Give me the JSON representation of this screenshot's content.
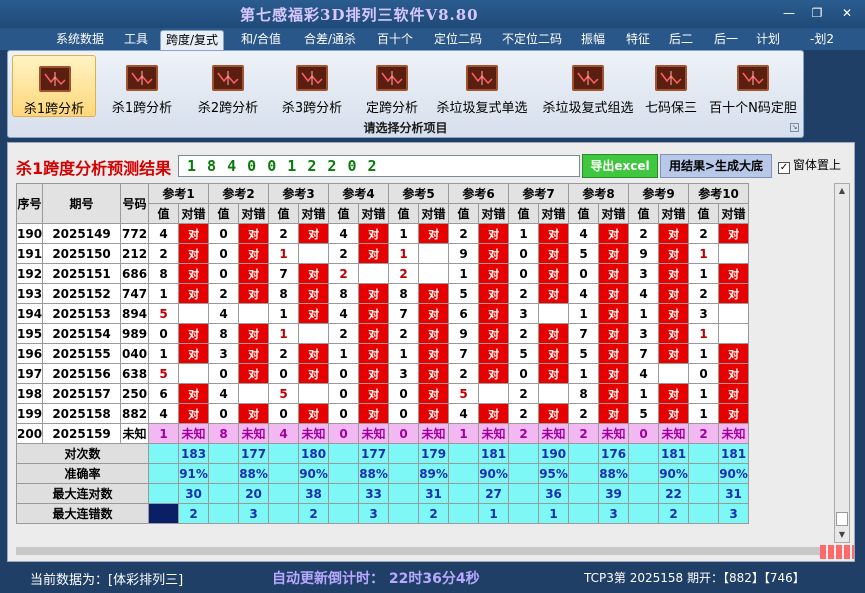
{
  "window": {
    "title": "第七感福彩3D排列三软件V8.80"
  },
  "menu": {
    "tabs": [
      "系统数据",
      "工具",
      "跨度/复式",
      "和/合值",
      "合差/通杀",
      "百十个",
      "定位二码",
      "不定位二码",
      "振幅",
      "特征",
      "后二",
      "后一",
      "计划",
      "-划2"
    ],
    "active_index": 2
  },
  "ribbon": {
    "buttons": [
      "杀1跨分析",
      "杀1跨分析",
      "杀2跨分析",
      "杀3跨分析",
      "定跨分析",
      "杀垃圾复式单选",
      "杀垃圾复式组选",
      "七码保三",
      "百十个N码定胆"
    ],
    "active_index": 0,
    "group_label": "请选择分析项目"
  },
  "result": {
    "title": "杀1跨度分析预测结果",
    "value": "1 8 4 0 0 1 2 2 0 2",
    "export_label": "导出excel",
    "generate_label": "用结果>生成大底",
    "topmost_label": "窗体置上",
    "topmost_checked": true
  },
  "table": {
    "head": {
      "seq": "序号",
      "period": "期号",
      "code": "号码",
      "value": "值",
      "match": "对错"
    },
    "refs": [
      "参考1",
      "参考2",
      "参考3",
      "参考4",
      "参考5",
      "参考6",
      "参考7",
      "参考8",
      "参考9",
      "参考10"
    ],
    "hit_text": "对",
    "rows": [
      {
        "seq": "190",
        "period": "2025149",
        "code": "772",
        "cells": [
          [
            "4",
            1
          ],
          [
            "0",
            1
          ],
          [
            "2",
            1
          ],
          [
            "4",
            1
          ],
          [
            "1",
            1
          ],
          [
            "2",
            1
          ],
          [
            "1",
            1
          ],
          [
            "4",
            1
          ],
          [
            "2",
            1
          ],
          [
            "2",
            1
          ]
        ]
      },
      {
        "seq": "191",
        "period": "2025150",
        "code": "212",
        "cells": [
          [
            "2",
            1
          ],
          [
            "0",
            1
          ],
          [
            "1r",
            0
          ],
          [
            "2",
            1
          ],
          [
            "1r",
            0
          ],
          [
            "9",
            1
          ],
          [
            "0",
            1
          ],
          [
            "5",
            1
          ],
          [
            "9",
            1
          ],
          [
            "1r",
            0
          ]
        ]
      },
      {
        "seq": "192",
        "period": "2025151",
        "code": "686",
        "cells": [
          [
            "8",
            1
          ],
          [
            "0",
            1
          ],
          [
            "7",
            1
          ],
          [
            "2r",
            0
          ],
          [
            "2r",
            0
          ],
          [
            "1",
            1
          ],
          [
            "0",
            1
          ],
          [
            "0",
            1
          ],
          [
            "3",
            1
          ],
          [
            "1",
            1
          ]
        ]
      },
      {
        "seq": "193",
        "period": "2025152",
        "code": "747",
        "cells": [
          [
            "1",
            1
          ],
          [
            "2",
            1
          ],
          [
            "8",
            1
          ],
          [
            "8",
            1
          ],
          [
            "8",
            1
          ],
          [
            "5",
            1
          ],
          [
            "2",
            1
          ],
          [
            "4",
            1
          ],
          [
            "4",
            1
          ],
          [
            "2",
            1
          ]
        ]
      },
      {
        "seq": "194",
        "period": "2025153",
        "code": "894",
        "cells": [
          [
            "5r",
            0
          ],
          [
            "4",
            0
          ],
          [
            "1",
            1
          ],
          [
            "4",
            1
          ],
          [
            "7",
            1
          ],
          [
            "6",
            1
          ],
          [
            "3",
            0
          ],
          [
            "1",
            1
          ],
          [
            "1",
            1
          ],
          [
            "3",
            0
          ]
        ]
      },
      {
        "seq": "195",
        "period": "2025154",
        "code": "989",
        "cells": [
          [
            "0",
            1
          ],
          [
            "8",
            1
          ],
          [
            "1r",
            0
          ],
          [
            "2",
            1
          ],
          [
            "2",
            1
          ],
          [
            "9",
            1
          ],
          [
            "2",
            1
          ],
          [
            "7",
            1
          ],
          [
            "3",
            1
          ],
          [
            "1r",
            0
          ]
        ]
      },
      {
        "seq": "196",
        "period": "2025155",
        "code": "040",
        "cells": [
          [
            "1",
            1
          ],
          [
            "3",
            1
          ],
          [
            "2",
            1
          ],
          [
            "1",
            1
          ],
          [
            "1",
            1
          ],
          [
            "7",
            1
          ],
          [
            "5",
            1
          ],
          [
            "5",
            1
          ],
          [
            "7",
            1
          ],
          [
            "1",
            1
          ]
        ]
      },
      {
        "seq": "197",
        "period": "2025156",
        "code": "638",
        "cells": [
          [
            "5r",
            0
          ],
          [
            "0",
            1
          ],
          [
            "0",
            1
          ],
          [
            "0",
            1
          ],
          [
            "3",
            1
          ],
          [
            "2",
            1
          ],
          [
            "0",
            1
          ],
          [
            "1",
            1
          ],
          [
            "4",
            0
          ],
          [
            "0",
            1
          ]
        ]
      },
      {
        "seq": "198",
        "period": "2025157",
        "code": "250",
        "cells": [
          [
            "6",
            1
          ],
          [
            "4",
            0
          ],
          [
            "5r",
            0
          ],
          [
            "0",
            1
          ],
          [
            "0",
            1
          ],
          [
            "5r",
            0
          ],
          [
            "2",
            0
          ],
          [
            "8",
            1
          ],
          [
            "1",
            1
          ],
          [
            "1",
            1
          ]
        ]
      },
      {
        "seq": "199",
        "period": "2025158",
        "code": "882",
        "cells": [
          [
            "4",
            1
          ],
          [
            "0",
            1
          ],
          [
            "0",
            1
          ],
          [
            "0",
            1
          ],
          [
            "0",
            1
          ],
          [
            "4",
            1
          ],
          [
            "2",
            1
          ],
          [
            "2",
            1
          ],
          [
            "5",
            1
          ],
          [
            "1",
            1
          ]
        ]
      }
    ],
    "unknown_row": {
      "seq": "200",
      "period": "2025159",
      "code": "未知",
      "unknown_text": "未知",
      "values": [
        "1",
        "8",
        "4",
        "0",
        "0",
        "1",
        "2",
        "2",
        "0",
        "2"
      ]
    },
    "stats": [
      {
        "label": "对次数",
        "values": [
          "183",
          "177",
          "180",
          "177",
          "179",
          "181",
          "190",
          "176",
          "181",
          "181"
        ]
      },
      {
        "label": "准确率",
        "values": [
          "91%",
          "88%",
          "90%",
          "88%",
          "89%",
          "90%",
          "95%",
          "88%",
          "90%",
          "90%"
        ]
      },
      {
        "label": "最大连对数",
        "values": [
          "30",
          "20",
          "38",
          "33",
          "31",
          "27",
          "36",
          "39",
          "22",
          "31"
        ]
      },
      {
        "label": "最大连错数",
        "values": [
          "2",
          "3",
          "2",
          "3",
          "2",
          "1",
          "1",
          "3",
          "2",
          "3"
        ]
      }
    ]
  },
  "status": {
    "current": "当前数据为：[体彩排列三]",
    "countdown": "自动更新倒计时：  22时36分4秒",
    "latest": "TCP3第 2025158 期开：【882】【746】"
  }
}
